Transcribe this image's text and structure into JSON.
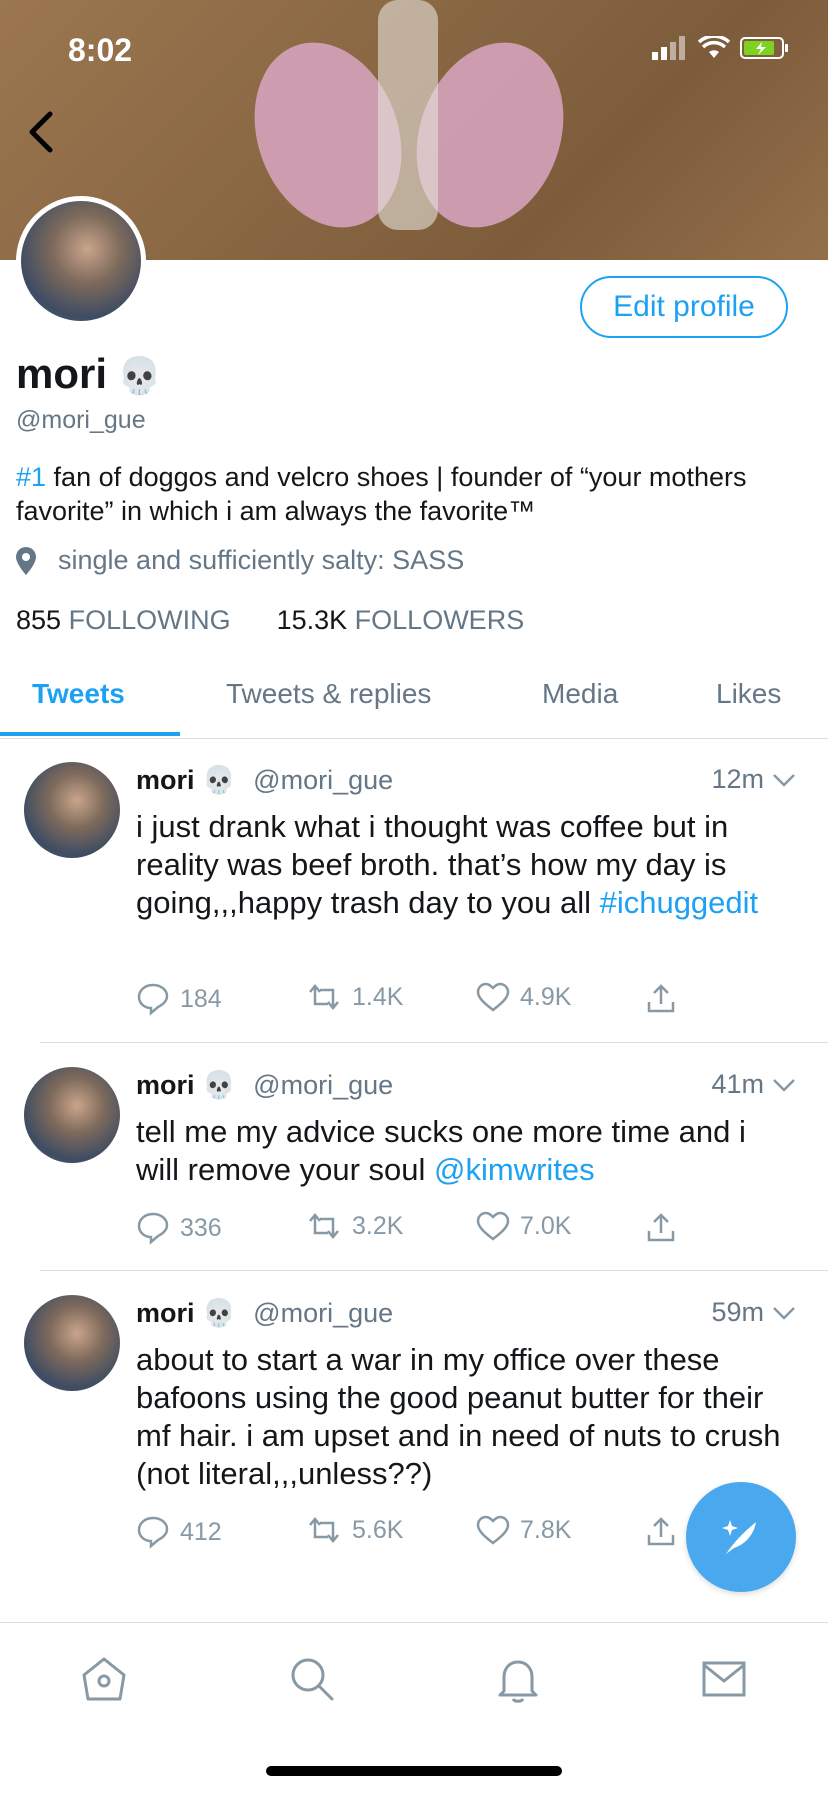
{
  "status_bar": {
    "time": "8:02"
  },
  "profile": {
    "name": "mori",
    "emoji": "💀",
    "handle": "@mori_gue",
    "edit_label": "Edit profile",
    "bio_hash": "#1",
    "bio_text": " fan of doggos and velcro shoes | founder of “your mothers favorite” in which i am always the favorite™",
    "location": "single and sufficiently salty: SASS",
    "following_count": "855",
    "following_label": "FOLLOWING",
    "followers_count": "15.3K",
    "followers_label": "FOLLOWERS"
  },
  "tabs": [
    "Tweets",
    "Tweets & replies",
    "Media",
    "Likes"
  ],
  "tweets": [
    {
      "name": "mori",
      "emoji": "💀",
      "handle": "@mori_gue",
      "time": "12m",
      "text": "i just drank what i thought was coffee but in reality was beef broth. that’s how my day is going,,,happy trash day to you all ",
      "link": "#ichuggedit",
      "replies": "184",
      "retweets": "1.4K",
      "likes": "4.9K"
    },
    {
      "name": "mori",
      "emoji": "💀",
      "handle": "@mori_gue",
      "time": "41m",
      "text": "tell me my advice sucks one more time and i will remove your soul ",
      "link": "@kimwrites",
      "replies": "336",
      "retweets": "3.2K",
      "likes": "7.0K"
    },
    {
      "name": "mori",
      "emoji": "💀",
      "handle": "@mori_gue",
      "time": "59m",
      "text": "about to start a war in my office over these bafoons using the good peanut butter for their mf hair. i am upset and in need of nuts to crush (not literal,,,unless??)",
      "link": "",
      "replies": "412",
      "retweets": "5.6K",
      "likes": "7.8K"
    }
  ],
  "colors": {
    "accent": "#1da1f2",
    "muted": "#657786",
    "fab": "#4aa8ee"
  },
  "nav": [
    "home-icon",
    "search-icon",
    "notifications-icon",
    "messages-icon"
  ]
}
